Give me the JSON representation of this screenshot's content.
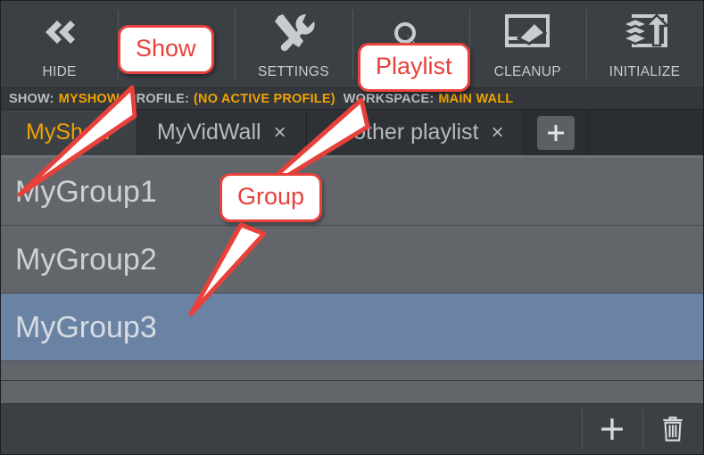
{
  "toolbar": {
    "buttons": [
      {
        "label": "HIDE",
        "icon": "double-chevron-left-icon"
      },
      {
        "label": "",
        "icon": "folder-icon"
      },
      {
        "label": "SETTINGS",
        "icon": "tools-icon"
      },
      {
        "label": "",
        "icon": "playlist-icon"
      },
      {
        "label": "CLEANUP",
        "icon": "eraser-screen-icon"
      },
      {
        "label": "INITIALIZE",
        "icon": "layers-upload-icon"
      }
    ]
  },
  "statusbar": {
    "items": [
      {
        "key": "SHOW:",
        "value": "MYSHOW"
      },
      {
        "key": "PROFILE:",
        "value": "(NO ACTIVE PROFILE)"
      },
      {
        "key": "WORKSPACE:",
        "value": "MAIN WALL"
      }
    ]
  },
  "tabs": {
    "items": [
      {
        "label": "MyShow",
        "active": true,
        "closable": false
      },
      {
        "label": "MyVidWall",
        "active": false,
        "closable": true,
        "close": "×"
      },
      {
        "label": "Another playlist",
        "active": false,
        "closable": true,
        "close": "×"
      }
    ],
    "add_label": "+"
  },
  "groups": {
    "rows": [
      {
        "name": "MyGroup1",
        "selected": false
      },
      {
        "name": "MyGroup2",
        "selected": false
      },
      {
        "name": "MyGroup3",
        "selected": true
      }
    ]
  },
  "bottombar": {
    "add_label": "+",
    "delete_label": "trash-icon"
  },
  "callouts": [
    {
      "text": "Show"
    },
    {
      "text": "Playlist"
    },
    {
      "text": "Group"
    }
  ],
  "colors": {
    "accent_orange": "#f0a202",
    "callout_red": "#e8403a",
    "selected_blue": "#6a82a4",
    "toolbar_bg": "#3b4045",
    "list_bg": "#62666a"
  }
}
